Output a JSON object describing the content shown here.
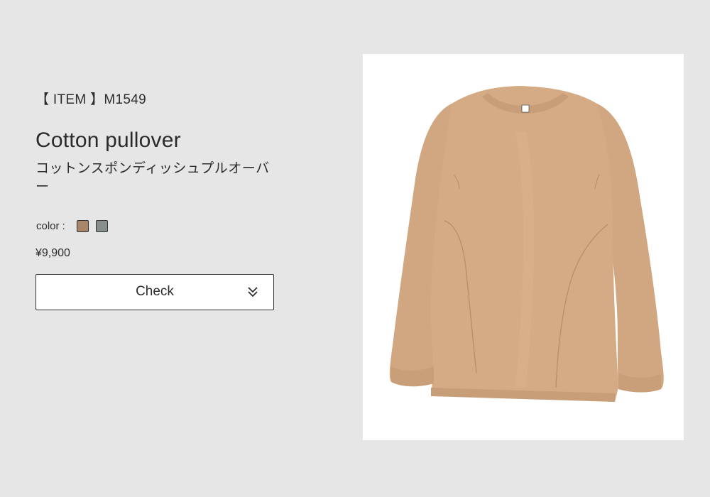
{
  "product": {
    "item_code": "【 ITEM 】M1549",
    "name": "Cotton pullover",
    "name_ja": "コットンスポンディッシュプルオーバー",
    "color_label": "color :",
    "colors": [
      "#a8866a",
      "#8a8e8a"
    ],
    "price": "¥9,900"
  },
  "actions": {
    "check_label": "Check",
    "check_icon": "double-chevron-down-icon"
  },
  "image": {
    "product_color": "#d4ab84",
    "background": "#ffffff"
  }
}
